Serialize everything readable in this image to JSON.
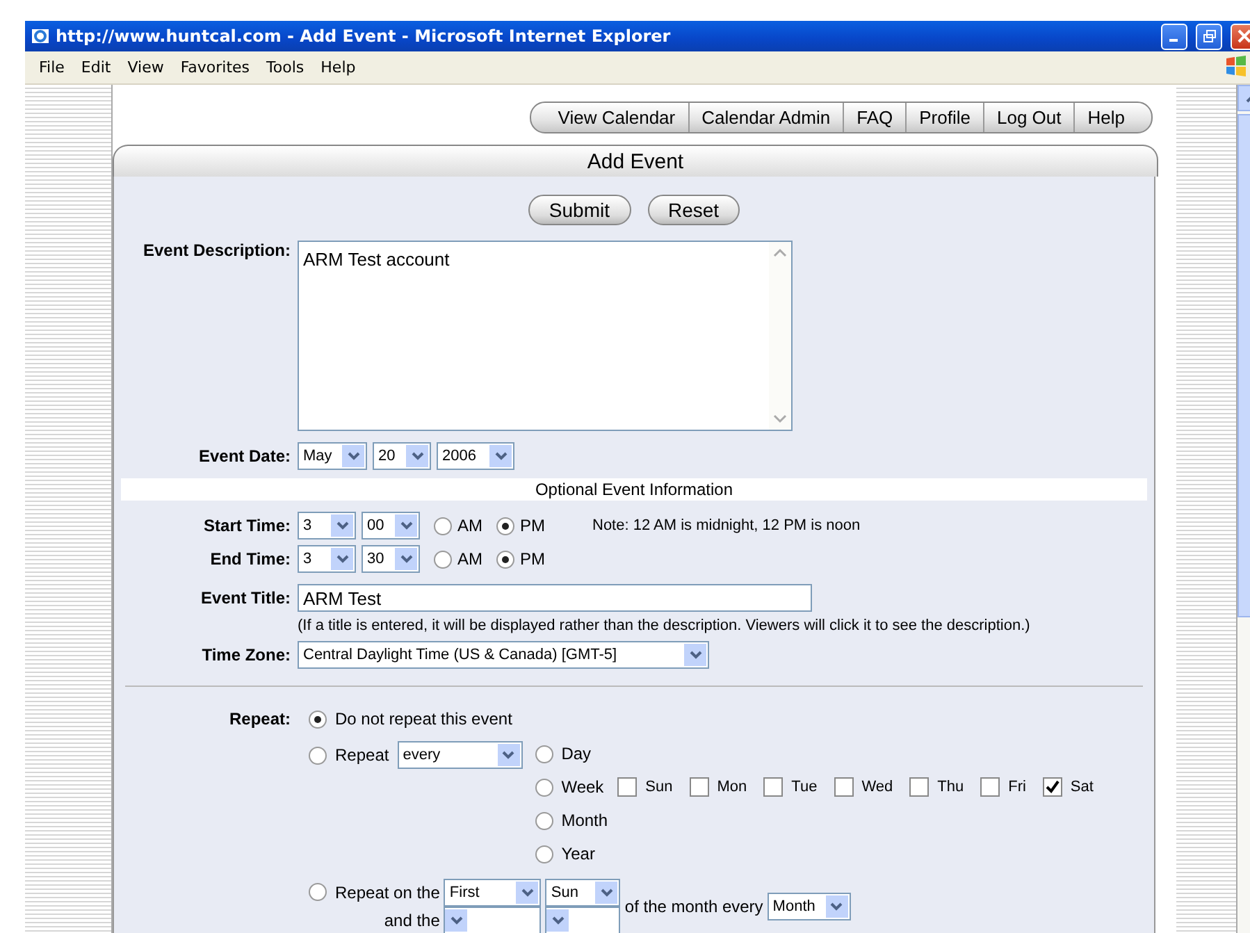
{
  "window": {
    "title": "http://www.huntcal.com - Add Event - Microsoft Internet Explorer"
  },
  "menu": [
    "File",
    "Edit",
    "View",
    "Favorites",
    "Tools",
    "Help"
  ],
  "nav": [
    "View Calendar",
    "Calendar Admin",
    "FAQ",
    "Profile",
    "Log Out",
    "Help"
  ],
  "header": "Add Event",
  "buttons": [
    "Submit",
    "Reset"
  ],
  "description": {
    "label": "Event Description:",
    "value": "ARM Test account"
  },
  "event_date": {
    "label": "Event Date:",
    "selects": [
      "May",
      "20",
      "2006"
    ]
  },
  "optional_heading": "Optional Event Information",
  "times": [
    {
      "label": "Start Time:",
      "hour": "3",
      "minute": "00",
      "options": [
        {
          "label": "AM",
          "selected": false
        },
        {
          "label": "PM",
          "selected": true
        }
      ],
      "note": "Note: 12 AM is midnight, 12 PM is noon"
    },
    {
      "label": "End Time:",
      "hour": "3",
      "minute": "30",
      "options": [
        {
          "label": "AM",
          "selected": false
        },
        {
          "label": "PM",
          "selected": true
        }
      ]
    }
  ],
  "event_title": {
    "label": "Event Title:",
    "value": "ARM Test",
    "hint": "(If a title is entered, it will be displayed rather than the description. Viewers will click it to see the description.)"
  },
  "time_zone": {
    "label": "Time Zone:",
    "value": "Central Daylight Time (US & Canada) [GMT-5]"
  },
  "repeat": {
    "label": "Repeat:",
    "none": {
      "label": "Do not repeat this event",
      "selected": true
    },
    "every": {
      "label": "Repeat",
      "select": "every",
      "selected": false,
      "units": [
        {
          "label": "Day",
          "selected": false
        },
        {
          "label": "Week",
          "selected": false,
          "days": [
            {
              "label": "Sun",
              "checked": false
            },
            {
              "label": "Mon",
              "checked": false
            },
            {
              "label": "Tue",
              "checked": false
            },
            {
              "label": "Wed",
              "checked": false
            },
            {
              "label": "Thu",
              "checked": false
            },
            {
              "label": "Fri",
              "checked": false
            },
            {
              "label": "Sat",
              "checked": true
            }
          ]
        },
        {
          "label": "Month",
          "selected": false
        },
        {
          "label": "Year",
          "selected": false
        }
      ]
    },
    "on_the": {
      "label": "Repeat on the",
      "selected": false,
      "ordinal": "First",
      "weekday": "Sun",
      "mid": "of the month every",
      "period": "Month",
      "and_label": "and the"
    }
  }
}
